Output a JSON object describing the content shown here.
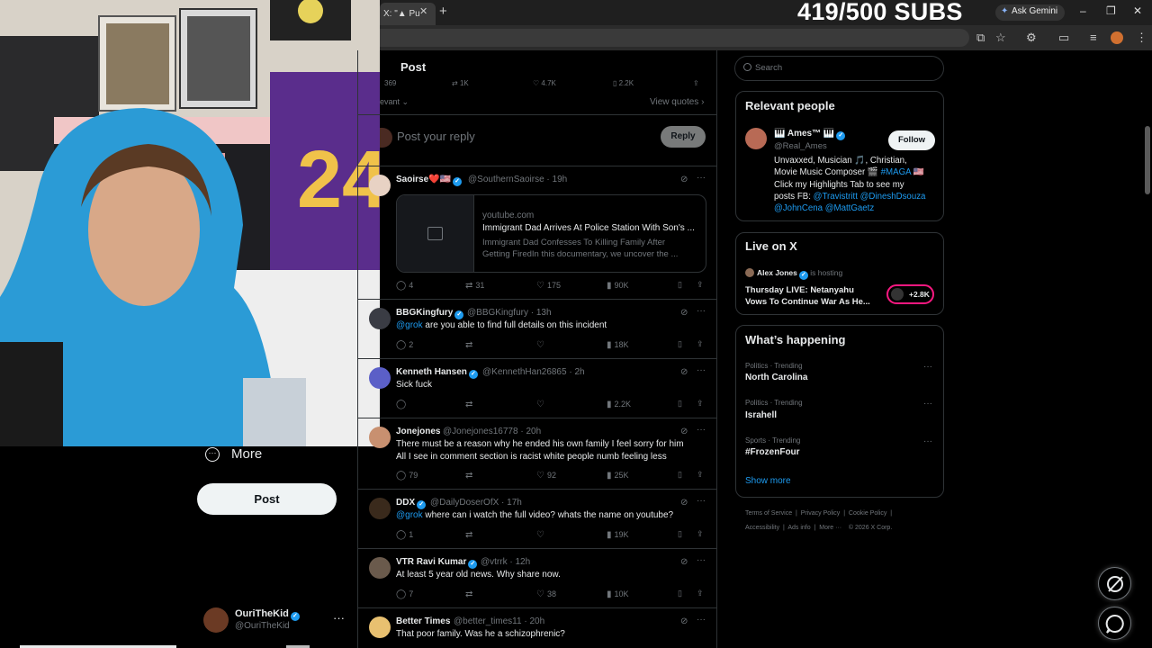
{
  "browser": {
    "tab_title": "X: \"▲ Pu",
    "overlay_subs": "419/500 SUBS",
    "gemini_label": "Ask Gemini"
  },
  "nav": {
    "more_label": "More",
    "post_label": "Post",
    "account": {
      "name": "OuriTheKid",
      "handle": "@OuriTheKid"
    }
  },
  "post": {
    "title": "Post",
    "top_stats": [
      "369",
      "1K",
      "4.7K",
      "2.2K"
    ],
    "sort_label": "evant",
    "view_quotes": "View quotes",
    "reply_placeholder": "Post your reply",
    "reply_button": "Reply"
  },
  "replies": [
    {
      "name": "Saoirse❤️🇺🇸",
      "handle": "@SouthernSaoirse",
      "time": "19h",
      "card": {
        "domain": "youtube.com",
        "title": "Immigrant Dad Arrives At Police Station With Son's ...",
        "desc1": "Immigrant Dad Confesses To Killing Family After",
        "desc2": "Getting FiredIn this documentary, we uncover the ..."
      },
      "stats": {
        "replies": "4",
        "reposts": "31",
        "likes": "175",
        "views": "90K"
      }
    },
    {
      "name": "BBGKingfury",
      "handle": "@BBGKingfury",
      "time": "13h",
      "mention": "@grok",
      "text": " are you able to find full details on this incident",
      "stats": {
        "replies": "2",
        "reposts": "",
        "likes": "",
        "views": "18K"
      }
    },
    {
      "name": "Kenneth Hansen",
      "handle": "@KennethHan26865",
      "time": "2h",
      "text": "Sick fuck",
      "stats": {
        "replies": "",
        "reposts": "",
        "likes": "",
        "views": "2.2K"
      }
    },
    {
      "name": "Jonejones",
      "handle": "@Jonejones16778",
      "time": "20h",
      "text": "There must be a reason why he ended his own family    I feel sorry for him",
      "text2": "All I see in comment section is racist white people  numb feeling less",
      "stats": {
        "replies": "79",
        "reposts": "",
        "likes": "92",
        "views": "25K"
      }
    },
    {
      "name": "DDX",
      "handle": "@DailyDoserOfX",
      "time": "17h",
      "mention": "@grok",
      "text": " where can i watch the full video? whats the name on youtube?",
      "stats": {
        "replies": "1",
        "reposts": "",
        "likes": "",
        "views": "19K"
      }
    },
    {
      "name": "VTR Ravi Kumar",
      "handle": "@vtrrk",
      "time": "12h",
      "text": "At least 5 year old news. Why share now.",
      "stats": {
        "replies": "7",
        "reposts": "",
        "likes": "38",
        "views": "10K"
      }
    },
    {
      "name": "Better Times",
      "handle": "@better_times11",
      "time": "20h",
      "text": "That poor family.  Was he a schizophrenic?"
    }
  ],
  "sidebar": {
    "search_placeholder": "Search",
    "relevant_title": "Relevant people",
    "person": {
      "name": "🎹 Ames™ 🎹",
      "handle": "@Real_Ames",
      "follow": "Follow",
      "bio1": "Unvaxxed, Musician 🎵, Christian,",
      "bio2a": "Movie Music Composer 🎬 ",
      "bio2b": "#MAGA",
      "bio2c": " 🇺🇸",
      "bio3": "Click my Highlights Tab to see my",
      "bio4a": "posts FB: ",
      "bio4b": "@Travistritt @DineshDsouza",
      "bio5": "@JohnCena @MattGaetz"
    },
    "live_title": "Live on X",
    "live": {
      "host": "Alex Jones",
      "hosting": "is hosting",
      "title1": "Thursday LIVE: Netanyahu",
      "title2": "Vows To Continue War As He...",
      "count": "+2.8K"
    },
    "happening_title": "What’s happening",
    "trends": [
      {
        "meta": "Politics · Trending",
        "name": "North Carolina"
      },
      {
        "meta": "Politics · Trending",
        "name": "Israhell"
      },
      {
        "meta": "Sports · Trending",
        "name": "#FrozenFour"
      }
    ],
    "show_more": "Show more",
    "footer1": [
      "Terms of Service",
      "Privacy Policy",
      "Cookie Policy"
    ],
    "footer2": [
      "Accessibility",
      "Ads info",
      "More ···",
      "© 2026 X Corp."
    ]
  },
  "colors": {
    "accent": "#1d9bf0",
    "live": "#f91880",
    "bg": "#000000"
  }
}
